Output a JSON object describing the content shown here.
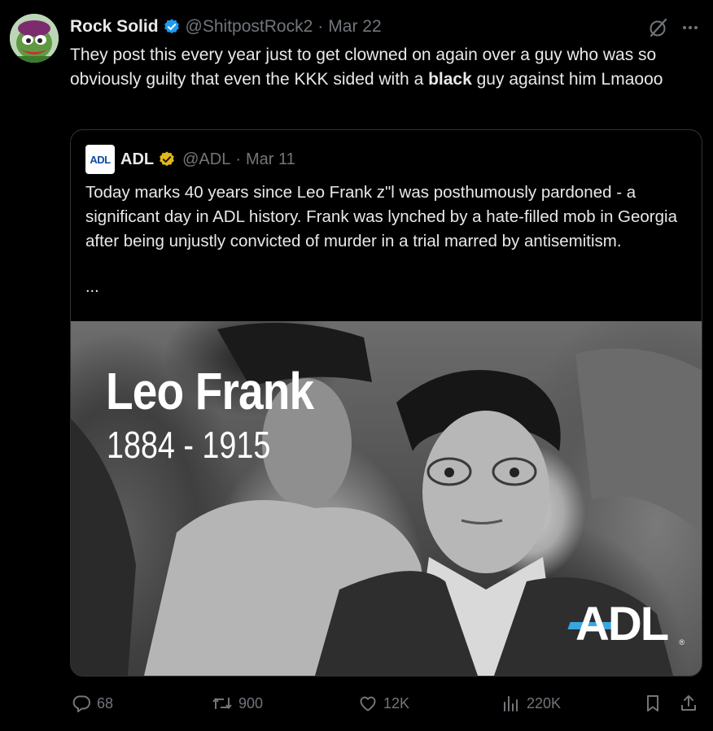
{
  "author": {
    "display_name": "Rock Solid",
    "handle": "@ShitpostRock2",
    "separator": "·",
    "date": "Mar 22",
    "verified_color": "#1d9bf0"
  },
  "tweet": {
    "text_before": "They post this every year just to get clowned on again over a guy who was so obviously guilty that even the KKK sided with a ",
    "text_bold": "black",
    "text_after": " guy against him Lmaooo"
  },
  "quote": {
    "avatar_text": "ADL",
    "display_name": "ADL",
    "handle": "@ADL",
    "separator": "·",
    "date": "Mar 11",
    "verified_color": "#e2b719",
    "text": "Today marks 40 years since Leo Frank z\"l was posthumously pardoned - a significant day in ADL history. Frank was lynched by a hate-filled mob in Georgia after being unjustly convicted of murder in a trial marred by antisemitism.",
    "ellipsis": "...",
    "media": {
      "title": "Leo Frank",
      "years": "1884 - 1915",
      "logo_text": "ADL",
      "logo_reg": "®",
      "logo_accent": "#3aa6e0"
    }
  },
  "actions": {
    "reply_count": "68",
    "retweet_count": "900",
    "like_count": "12K",
    "view_count": "220K"
  },
  "icons": [
    "verified-badge-icon",
    "grok-icon",
    "more-icon",
    "reply-icon",
    "retweet-icon",
    "like-icon",
    "views-icon",
    "bookmark-icon",
    "share-icon"
  ]
}
